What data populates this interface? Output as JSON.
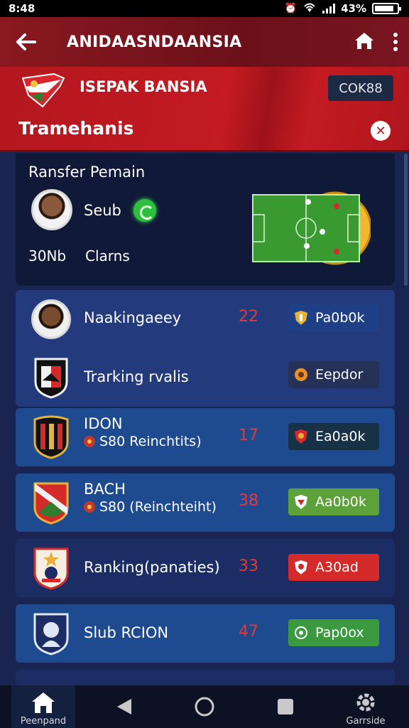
{
  "status_bar": {
    "time": "8:48",
    "battery": "43%"
  },
  "app_bar": {
    "title": "ANIDAASNDAANSIA"
  },
  "banner": {
    "brand_name": "ISEPAK BANSIA",
    "code_chip": "COK88",
    "section_title": "Tramehanis"
  },
  "transfer": {
    "title": "Ransfer Pemain",
    "club": "Seub",
    "stats_value": "30Nb",
    "stats_label": "Clarns"
  },
  "rows": [
    {
      "name": "Naakingaeey",
      "sub": "",
      "number": "22",
      "button": "Pa0b0k",
      "btn_color": "#1f3f86",
      "btn_icon": "shield-icon"
    },
    {
      "name": "Trarking rvalis",
      "sub": "",
      "number": "",
      "button": "Eepdor",
      "btn_color": "#253156",
      "btn_icon": "badge-icon"
    },
    {
      "name": "IDON",
      "sub": "S80 Reinchtits)",
      "number": "17",
      "button": "Ea0a0k",
      "btn_color": "#173246",
      "btn_icon": "shield-icon"
    },
    {
      "name": "BACH",
      "sub": "S80 (Reinchteiht)",
      "number": "38",
      "button": "Aa0b0k",
      "btn_color": "#5da13a",
      "btn_icon": "shield-icon"
    },
    {
      "name": "Ranking(panaties)",
      "sub": "",
      "number": "33",
      "button": "A30ad",
      "btn_color": "#d42a2a",
      "btn_icon": "shield-icon"
    },
    {
      "name": "Slub RCION",
      "sub": "",
      "number": "47",
      "button": "Pap0ox",
      "btn_color": "#3b9a3f",
      "btn_icon": "circle-icon"
    }
  ],
  "bottom_nav": {
    "home_label": "Peenpand",
    "profile_label": "Garrside"
  },
  "colors": {
    "appbar_red": "#8a1820",
    "banner_red": "#c41a22",
    "background_navy": "#1a2450",
    "number_red": "#e23a3a"
  }
}
